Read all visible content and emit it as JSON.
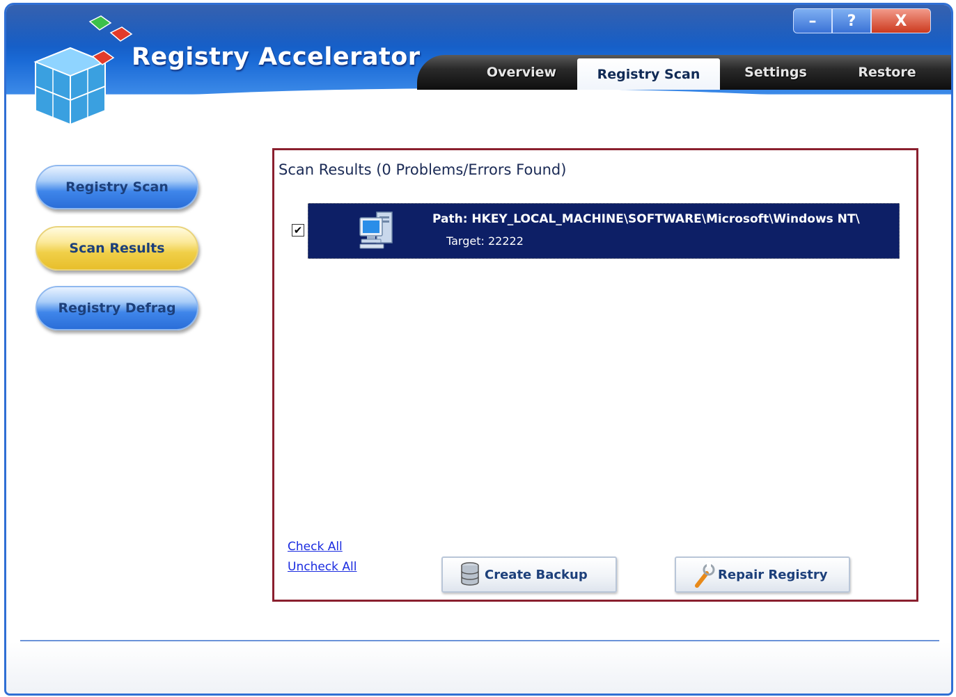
{
  "app": {
    "title": "Registry Accelerator"
  },
  "window_controls": {
    "minimize": "–",
    "help": "?",
    "close": "X"
  },
  "tabs": [
    {
      "label": "Overview",
      "active": false
    },
    {
      "label": "Registry Scan",
      "active": true
    },
    {
      "label": "Settings",
      "active": false
    },
    {
      "label": "Restore",
      "active": false
    }
  ],
  "sidebar": {
    "items": [
      {
        "label": "Registry Scan",
        "style": "blue"
      },
      {
        "label": "Scan Results",
        "style": "yellow",
        "active": true
      },
      {
        "label": "Registry Defrag",
        "style": "blue"
      }
    ]
  },
  "results": {
    "title": "Scan Results (0 Problems/Errors Found)",
    "rows": [
      {
        "checked": true,
        "path": "Path: HKEY_LOCAL_MACHINE\\SOFTWARE\\Microsoft\\Windows NT\\",
        "target": "Target: 22222",
        "icon": "computer-icon"
      }
    ],
    "check_all": "Check All",
    "uncheck_all": "Uncheck All",
    "create_backup": "Create Backup",
    "repair_registry": "Repair Registry"
  },
  "colors": {
    "panel_border": "#8a1f2e",
    "row_highlight": "#0d1f66",
    "link": "#1a2be0",
    "header_blue": "#1a6ad6"
  }
}
